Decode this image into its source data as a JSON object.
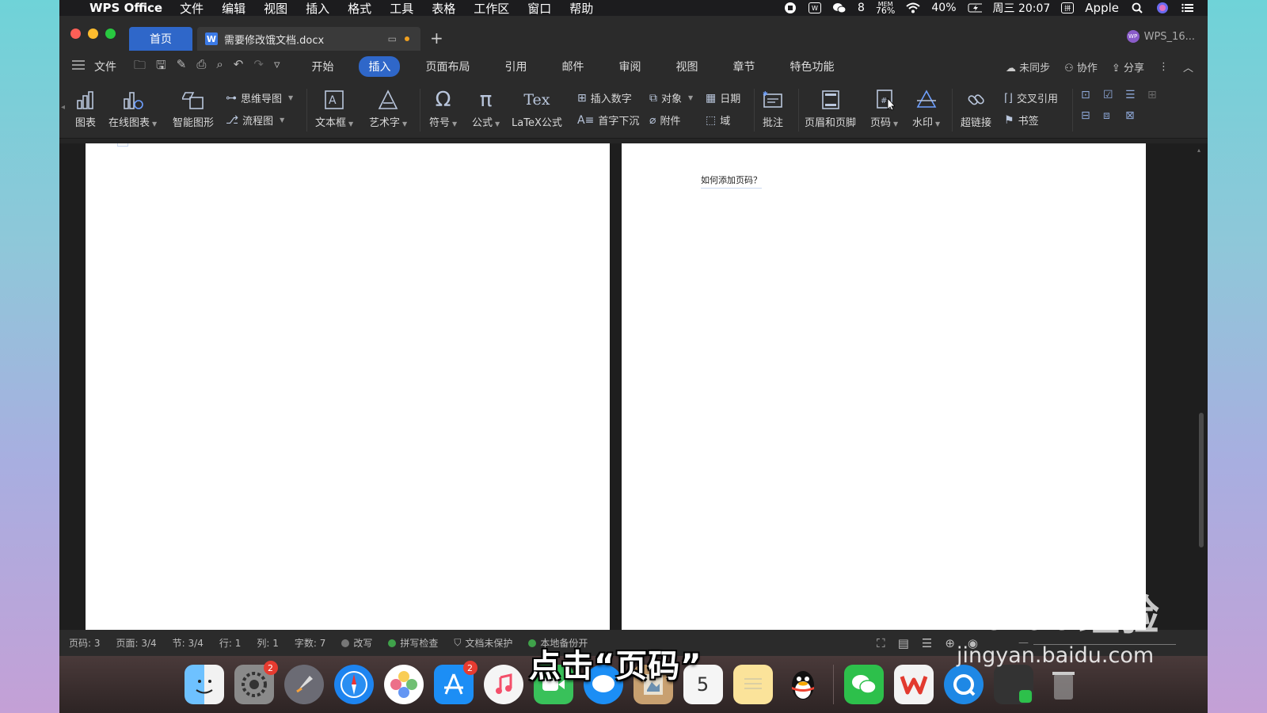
{
  "menubar": {
    "app_name": "WPS Office",
    "items": [
      "文件",
      "编辑",
      "视图",
      "插入",
      "格式",
      "工具",
      "表格",
      "工作区",
      "窗口",
      "帮助"
    ],
    "wechat_count": "8",
    "mem_label": "MEM",
    "mem_value": "76%",
    "battery": "40%",
    "clock": "周三 20:07",
    "input_method": "拼",
    "user": "Apple"
  },
  "tabs": {
    "home": "首页",
    "doc": "需要修改饿文档.docx",
    "doc_icon": "W",
    "plus": "+",
    "account": "WPS_16..."
  },
  "menurow": {
    "file": "文件",
    "ribbon_tabs": [
      "开始",
      "插入",
      "页面布局",
      "引用",
      "邮件",
      "审阅",
      "视图",
      "章节",
      "特色功能"
    ],
    "active_tab": "插入",
    "unsync": "未同步",
    "collab": "协作",
    "share": "分享"
  },
  "ribbon": {
    "chart": "图表",
    "online_chart": "在线图表",
    "smart_shape": "智能图形",
    "mind_map": "思维导图",
    "flowchart": "流程图",
    "textbox": "文本框",
    "wordart": "艺术字",
    "symbol": "符号",
    "formula": "公式",
    "latex": "LaTeX公式",
    "latex_icon": "Tex",
    "insert_number": "插入数字",
    "drop_cap": "首字下沉",
    "object": "对象",
    "attachment": "附件",
    "date": "日期",
    "field": "域",
    "comment": "批注",
    "header_footer": "页眉和页脚",
    "page_number": "页码",
    "watermark": "水印",
    "hyperlink": "超链接",
    "cross_ref": "交叉引用",
    "bookmark": "书签"
  },
  "document": {
    "right_page_text": "如何添加页码？"
  },
  "statusbar": {
    "page_code": "页码: 3",
    "page": "页面: 3/4",
    "section": "节: 3/4",
    "row": "行: 1",
    "col": "列: 1",
    "words": "字数: 7",
    "overwrite": "改写",
    "spellcheck": "拼写检查",
    "protect": "文档未保护",
    "backup": "本地备份开"
  },
  "dock": {
    "settings_badge": "2",
    "appstore_badge": "2",
    "calendar_day": "5"
  },
  "overlay": {
    "caption": "点击“页码”",
    "watermark_logo": "Baidu经验",
    "watermark_url": "jingyan.baidu.com"
  },
  "colors": {
    "accent": "#2f67c9",
    "window_bg": "#2b2b2b",
    "page_bg": "#ffffff"
  }
}
